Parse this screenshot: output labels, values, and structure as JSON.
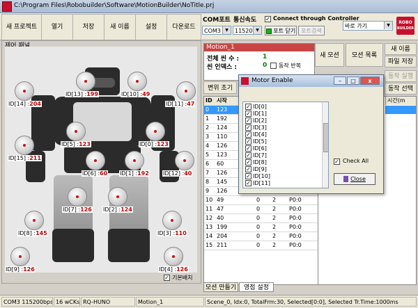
{
  "window": {
    "title": "C:\\Program Files\\Robobuilder\\Software\\MotionBuilder\\NoTitle.prj"
  },
  "toolbar": {
    "new_project": "새 프로젝트",
    "open": "열기",
    "save": "저장",
    "save_as": "새 이름",
    "settings": "설정",
    "download": "다운로드",
    "com_port_label": "COM포트",
    "baud_label": "통신속도",
    "com_value": "COM3",
    "baud_value": "115200",
    "connect_label": "Connect through Controller",
    "port_close": "포트 닫기",
    "port_search": "포트검색",
    "goto_value": "바로 가기",
    "logo_line1": "ROBO",
    "logo_line2": "BUILDER"
  },
  "panel": {
    "title": "제어 패널",
    "base_pose": "기본배치",
    "servos": [
      {
        "id": "ID[14] :",
        "val": "204"
      },
      {
        "id": "ID[13] :",
        "val": "199"
      },
      {
        "id": "ID[10] :",
        "val": "49"
      },
      {
        "id": "ID[11] :",
        "val": "47"
      },
      {
        "id": "ID[15] :",
        "val": "211"
      },
      {
        "id": "ID[5] :",
        "val": "123"
      },
      {
        "id": "ID[0] :",
        "val": "123"
      },
      {
        "id": "ID[6] :",
        "val": "60"
      },
      {
        "id": "ID[1] :",
        "val": "192"
      },
      {
        "id": "ID[12] :",
        "val": "40"
      },
      {
        "id": "ID[7] :",
        "val": "126"
      },
      {
        "id": "ID[2] :",
        "val": "124"
      },
      {
        "id": "ID[8] :",
        "val": "145"
      },
      {
        "id": "ID[3] :",
        "val": "110"
      },
      {
        "id": "ID[9] :",
        "val": "126"
      },
      {
        "id": "ID[4] :",
        "val": "126"
      }
    ]
  },
  "motion": {
    "name": "Motion_1",
    "total_scenes_label": "전체 씬 수 :",
    "total_scenes": "1",
    "scene_index_label": "씬 인덱스 :",
    "scene_index": "0",
    "repeat_label": "동작 반복",
    "new_motion": "새 모션",
    "motion_list": "모션 목록",
    "rename": "새 이름",
    "file_save": "파일 저장",
    "var_init": "변위 초기",
    "play_exec": "동작 실행",
    "scene_select": "동작 선택",
    "time_header": "시간(m"
  },
  "table": {
    "headers": [
      "ID",
      "시작"
    ],
    "rows": [
      [
        "0",
        "123",
        "",
        "",
        ""
      ],
      [
        "1",
        "192",
        "",
        "",
        ""
      ],
      [
        "2",
        "124",
        "",
        "",
        ""
      ],
      [
        "3",
        "110",
        "",
        "",
        ""
      ],
      [
        "4",
        "126",
        "",
        "",
        ""
      ],
      [
        "5",
        "123",
        "",
        "",
        ""
      ],
      [
        "6",
        "60",
        "",
        "",
        ""
      ],
      [
        "7",
        "126",
        "",
        "",
        ""
      ],
      [
        "8",
        "145",
        "",
        "",
        ""
      ],
      [
        "9",
        "126",
        "0",
        "2",
        "P0:0"
      ],
      [
        "10",
        "49",
        "0",
        "2",
        "P0:0"
      ],
      [
        "11",
        "47",
        "0",
        "2",
        "P0:0"
      ],
      [
        "12",
        "40",
        "0",
        "2",
        "P0:0"
      ],
      [
        "13",
        "199",
        "0",
        "2",
        "P0:0"
      ],
      [
        "14",
        "204",
        "0",
        "2",
        "P0:0"
      ],
      [
        "15",
        "211",
        "0",
        "2",
        "P0:0"
      ]
    ]
  },
  "tabs": {
    "make_motion": "모션 만들기",
    "env_settings": "영점 설정"
  },
  "status": {
    "port": "COM3  115200bps",
    "cks": "16 wCKs",
    "model": "RQ-HUNO",
    "motion": "Motion_1",
    "info": "Scene_0, Idx:0, TotalFrm:30, Selected[0:0], Selected Tr.Time:1000ms"
  },
  "dialog": {
    "title": "Motor Enable",
    "check_all": "Check All",
    "close": "Close",
    "items": [
      "ID[0]",
      "ID[1]",
      "ID[2]",
      "ID[3]",
      "ID[4]",
      "ID[5]",
      "ID[6]",
      "ID[7]",
      "ID[8]",
      "ID[9]",
      "ID[10]",
      "ID[11]"
    ]
  },
  "colors": {
    "accent_red": "#c94545",
    "selected_row": "#3399ff",
    "value_green": "#008000"
  }
}
